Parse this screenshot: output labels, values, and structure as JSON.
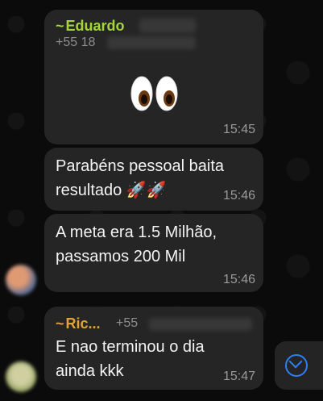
{
  "messages": [
    {
      "sender": "Eduardo",
      "sender_color": "#a4d63c",
      "phone_prefix": "+55 18",
      "content_emoji": "eyes",
      "time": "15:45"
    },
    {
      "lines": [
        "Parabéns pessoal baita",
        "resultado 🚀🚀"
      ],
      "time": "15:46"
    },
    {
      "lines": [
        "A meta era 1.5 Milhão,",
        "passamos 200 Mil"
      ],
      "time": "15:46"
    },
    {
      "sender": "Ric...",
      "sender_color": "#e0a33a",
      "phone_prefix": "+55",
      "lines": [
        "E nao terminou o dia",
        "ainda kkk"
      ],
      "time": "15:47"
    }
  ],
  "tilde": "~",
  "icons": {
    "scroll_down": "chevron-down-icon",
    "accent": "#2f7ff0"
  }
}
